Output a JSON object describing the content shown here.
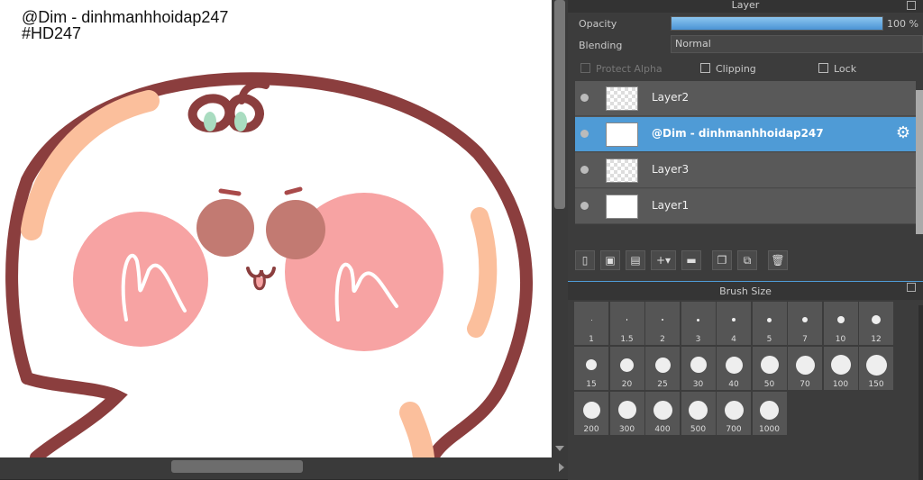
{
  "watermark": {
    "line1": "@Dim - dinhmanhhoidap247",
    "line2": "#HD247"
  },
  "layer_panel": {
    "title": "Layer",
    "opacity_label": "Opacity",
    "opacity_value": "100 %",
    "opacity_fraction": 1.0,
    "blending_label": "Blending",
    "blending_value": "Normal",
    "protect_alpha_label": "Protect Alpha",
    "clipping_label": "Clipping",
    "lock_label": "Lock",
    "layers": [
      {
        "name": "Layer2",
        "selected": false
      },
      {
        "name": "@Dim - dinhmanhhoidap247",
        "selected": true
      },
      {
        "name": "Layer3",
        "selected": false
      },
      {
        "name": "Layer1",
        "selected": false
      }
    ],
    "toolbar_icons": [
      "new-layer-icon",
      "new-raster-layer-icon",
      "new-halftone-layer-icon",
      "add-layer-dropdown-icon",
      "new-folder-icon",
      "duplicate-layer-icon",
      "merge-layer-icon",
      "delete-layer-icon"
    ]
  },
  "brush_panel": {
    "title": "Brush Size",
    "sizes": [
      "1",
      "1.5",
      "2",
      "3",
      "4",
      "5",
      "7",
      "10",
      "12",
      "15",
      "20",
      "25",
      "30",
      "40",
      "50",
      "70",
      "100",
      "150",
      "200",
      "300",
      "400",
      "500",
      "700",
      "1000"
    ]
  },
  "colors": {
    "accent": "#4f9bd6",
    "panel_bg": "#3c3c3c",
    "outline": "#8b3e3e",
    "cheek": "#f7a3a3",
    "leaf": "#a9dcc0"
  }
}
